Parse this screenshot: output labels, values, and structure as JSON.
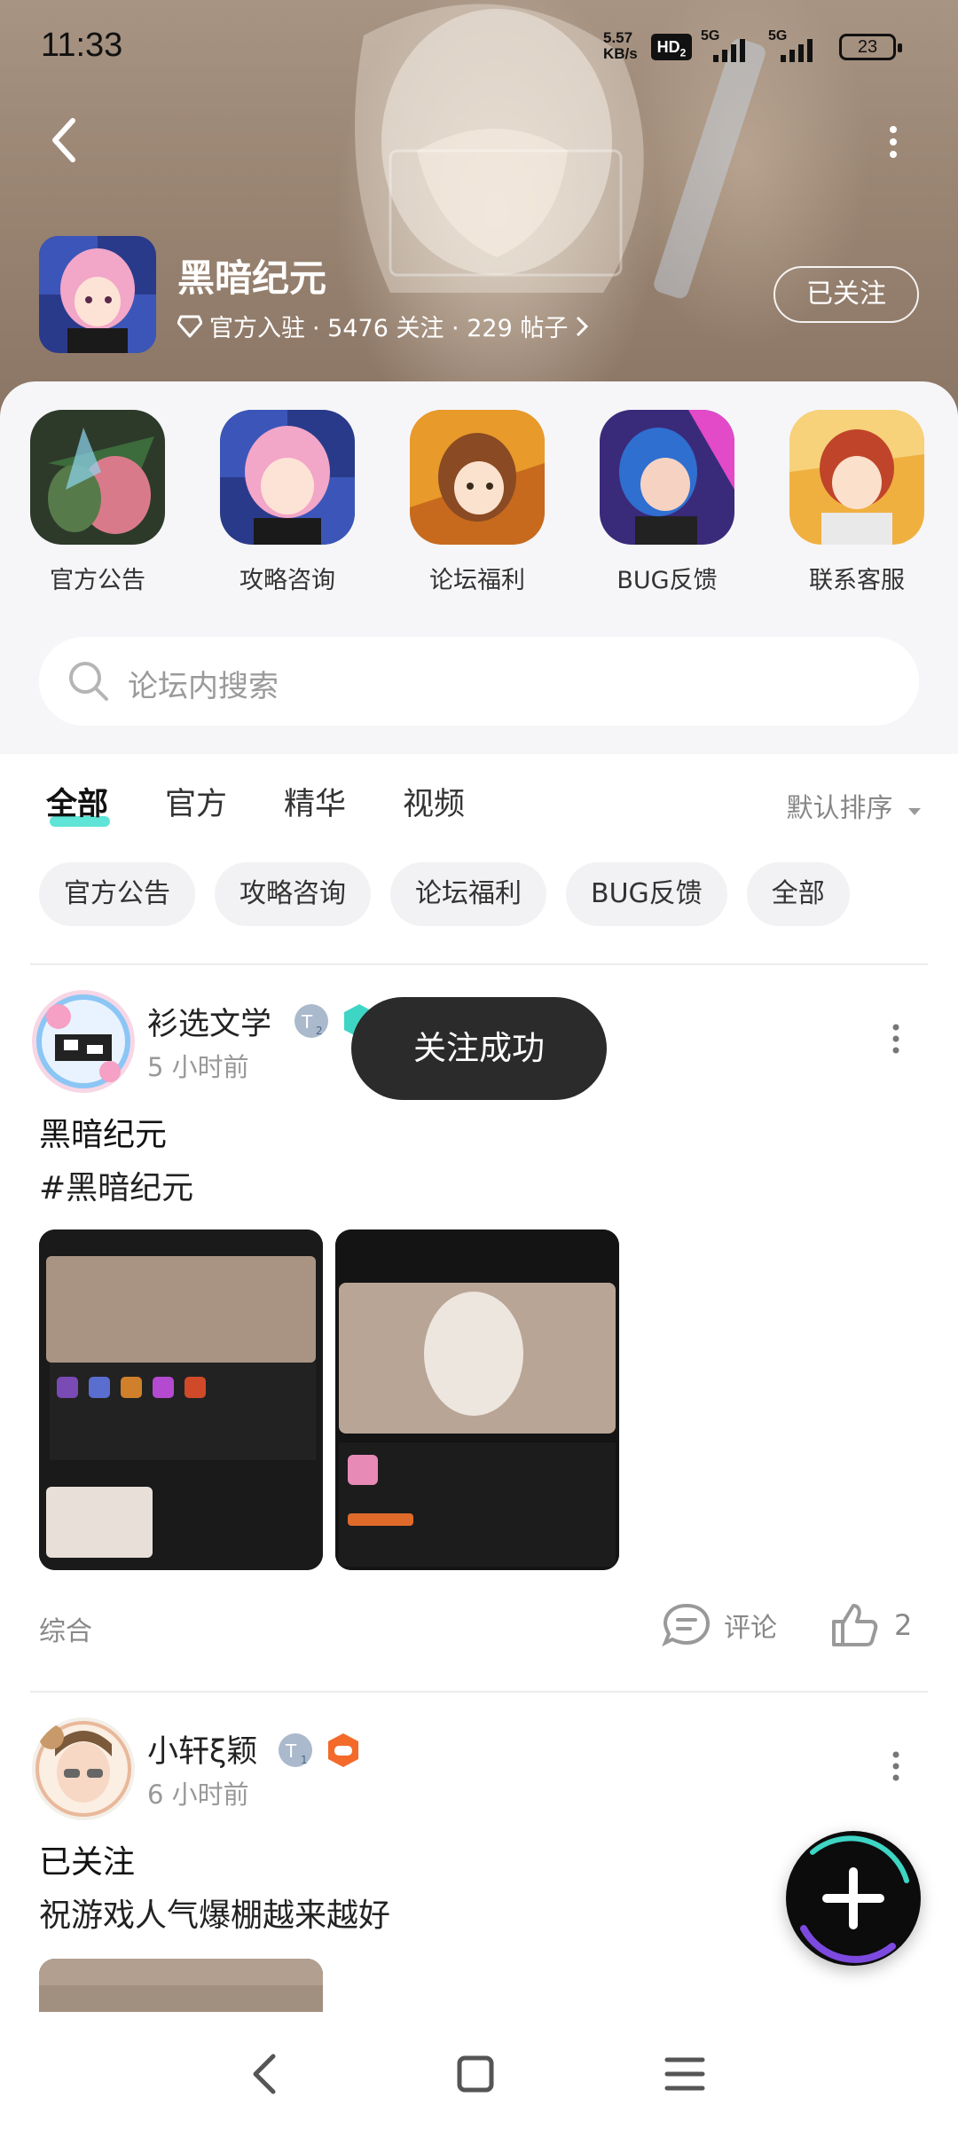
{
  "status_bar": {
    "time": "11:33",
    "net_speed_value": "5.57",
    "net_speed_unit": "KB/s",
    "hd_label": "HD",
    "hd_sub": "2",
    "signal_1": "5G",
    "signal_2": "5G",
    "battery": "23"
  },
  "header": {
    "game_name": "黑暗纪元",
    "official_label": "官方入驻",
    "stats": "· 5476 关注 · 229 帖子",
    "follow_button": "已关注"
  },
  "quick_links": [
    {
      "label": "官方公告"
    },
    {
      "label": "攻略咨询"
    },
    {
      "label": "论坛福利"
    },
    {
      "label": "BUG反馈"
    },
    {
      "label": "联系客服"
    }
  ],
  "search": {
    "placeholder": "论坛内搜索"
  },
  "tabs": [
    "全部",
    "官方",
    "精华",
    "视频"
  ],
  "sort_label": "默认排序",
  "chips": [
    "官方公告",
    "攻略咨询",
    "论坛福利",
    "BUG反馈",
    "全部"
  ],
  "posts": [
    {
      "author": "衫选文学",
      "level": "2",
      "time": "5 小时前",
      "title": "黑暗纪元",
      "body": "#黑暗纪元",
      "category": "综合",
      "comment_label": "评论",
      "likes": "2"
    },
    {
      "author": "小轩ξ颖",
      "level": "1",
      "time": "6 小时前",
      "title": "已关注",
      "body": "祝游戏人气爆棚越来越好"
    }
  ],
  "toast": "关注成功",
  "colors": {
    "accent": "#43e0d0",
    "toast_bg": "#2b2b2b",
    "banner": "#9a8573"
  }
}
